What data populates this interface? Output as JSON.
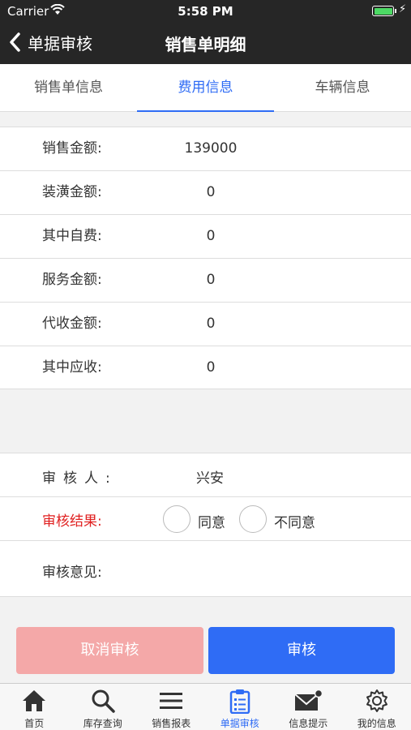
{
  "status_bar": {
    "carrier": "Carrier",
    "time": "5:58 PM",
    "battery_level": 1.0
  },
  "nav": {
    "back_label": "单据审核",
    "title": "销售单明细"
  },
  "tabs": [
    {
      "label": "销售单信息",
      "active": false
    },
    {
      "label": "费用信息",
      "active": true
    },
    {
      "label": "车辆信息",
      "active": false
    }
  ],
  "fees": [
    {
      "label": "销售金额:",
      "value": "139000"
    },
    {
      "label": "装潢金额:",
      "value": "0"
    },
    {
      "label": "其中自费:",
      "value": "0"
    },
    {
      "label": "服务金额:",
      "value": "0"
    },
    {
      "label": "代收金额:",
      "value": "0"
    },
    {
      "label": "其中应收:",
      "value": "0"
    }
  ],
  "review": {
    "reviewer_label": "审核人:",
    "reviewer_value": "兴安",
    "result_label": "审核结果:",
    "options": [
      "同意",
      "不同意"
    ],
    "opinion_label": "审核意见:"
  },
  "buttons": {
    "cancel": "取消审核",
    "approve": "审核"
  },
  "tabbar": [
    {
      "label": "首页",
      "icon": "home-icon"
    },
    {
      "label": "库存查询",
      "icon": "search-icon"
    },
    {
      "label": "销售报表",
      "icon": "menu-icon"
    },
    {
      "label": "单据审核",
      "icon": "clipboard-icon",
      "active": true
    },
    {
      "label": "信息提示",
      "icon": "mail-icon"
    },
    {
      "label": "我的信息",
      "icon": "gear-icon"
    }
  ],
  "colors": {
    "accent": "#2f6cf5",
    "cancel": "#f4a8a8",
    "required": "#e02020",
    "header": "#262626",
    "battery": "#4cd964"
  }
}
